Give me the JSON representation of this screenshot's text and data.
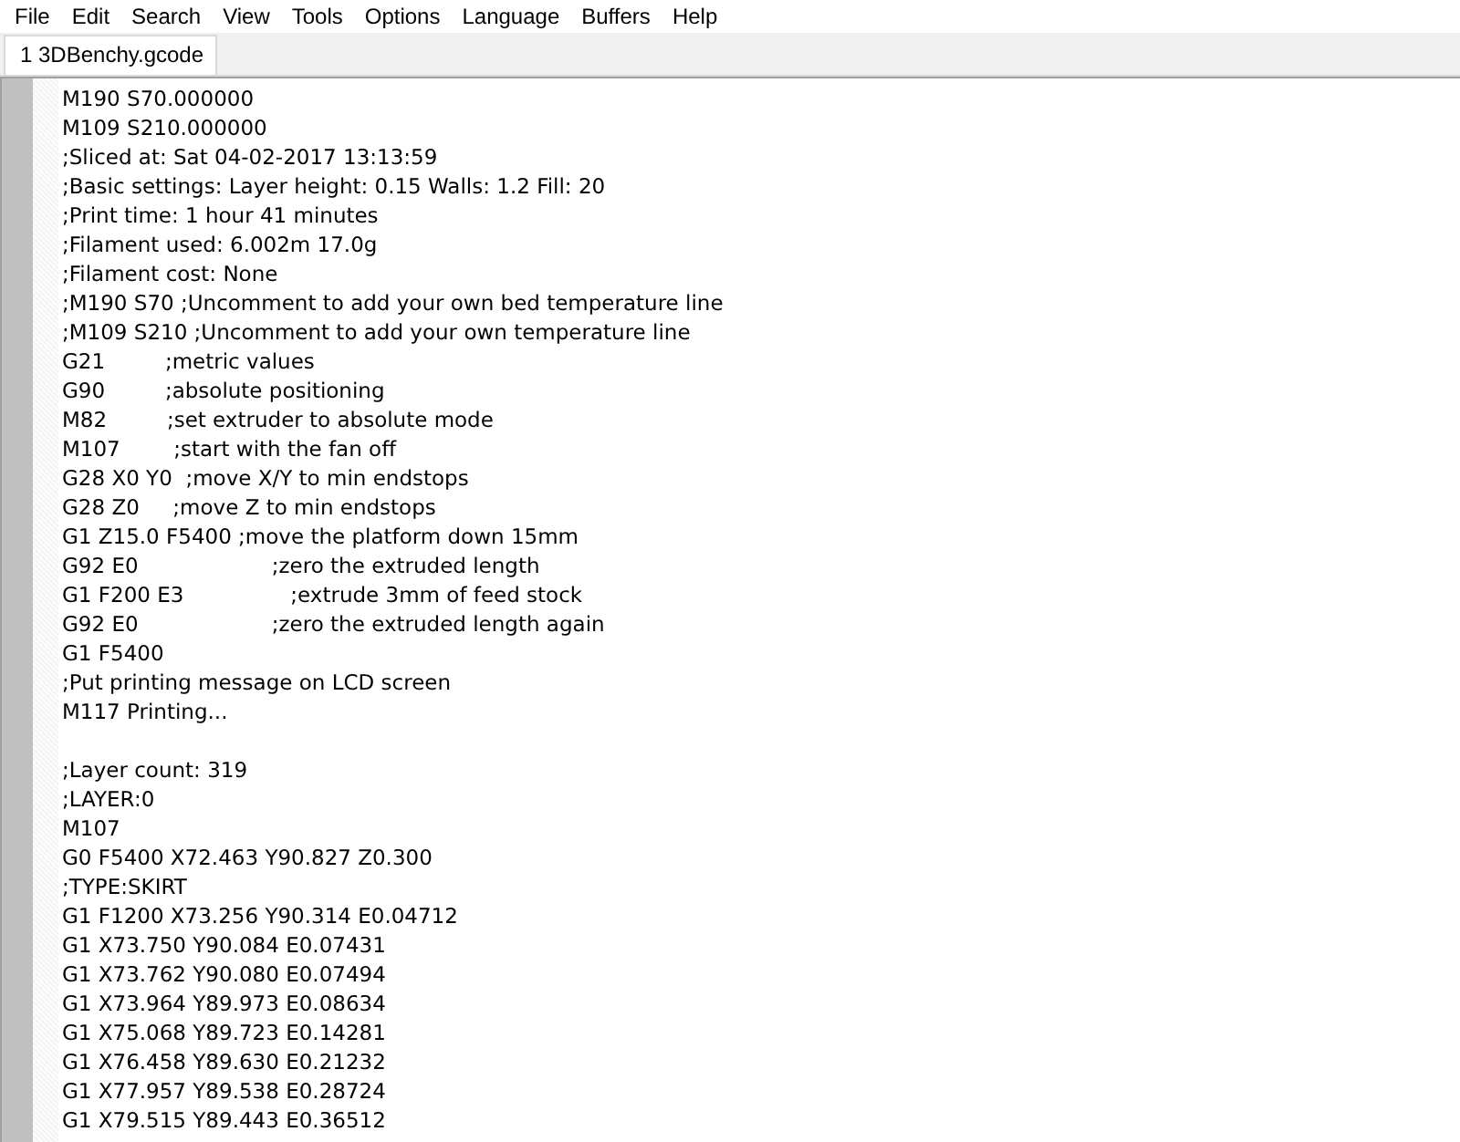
{
  "menu": [
    "File",
    "Edit",
    "Search",
    "View",
    "Tools",
    "Options",
    "Language",
    "Buffers",
    "Help"
  ],
  "tabs": [
    {
      "label": "1 3DBenchy.gcode",
      "selected": true
    }
  ],
  "editor": {
    "blocks": [
      [
        "M190 S70.000000",
        "M109 S210.000000",
        ";Sliced at: Sat 04-02-2017 13:13:59",
        ";Basic settings: Layer height: 0.15 Walls: 1.2 Fill: 20",
        ";Print time: 1 hour 41 minutes",
        ";Filament used: 6.002m 17.0g",
        ";Filament cost: None",
        ";M190 S70 ;Uncomment to add your own bed temperature line",
        ";M109 S210 ;Uncomment to add your own temperature line",
        "G21         ;metric values",
        "G90         ;absolute positioning",
        "M82         ;set extruder to absolute mode",
        "M107        ;start with the fan off",
        "G28 X0 Y0  ;move X/Y to min endstops",
        "G28 Z0     ;move Z to min endstops",
        "G1 Z15.0 F5400 ;move the platform down 15mm",
        "G92 E0                    ;zero the extruded length",
        "G1 F200 E3                ;extrude 3mm of feed stock",
        "G92 E0                    ;zero the extruded length again",
        "G1 F5400",
        ";Put printing message on LCD screen",
        "M117 Printing..."
      ],
      [
        ";Layer count: 319",
        ";LAYER:0",
        "M107",
        "G0 F5400 X72.463 Y90.827 Z0.300",
        ";TYPE:SKIRT",
        "G1 F1200 X73.256 Y90.314 E0.04712",
        "G1 X73.750 Y90.084 E0.07431",
        "G1 X73.762 Y90.080 E0.07494",
        "G1 X73.964 Y89.973 E0.08634",
        "G1 X75.068 Y89.723 E0.14281",
        "G1 X76.458 Y89.630 E0.21232",
        "G1 X77.957 Y89.538 E0.28724",
        "G1 X79.515 Y89.443 E0.36512"
      ]
    ]
  }
}
